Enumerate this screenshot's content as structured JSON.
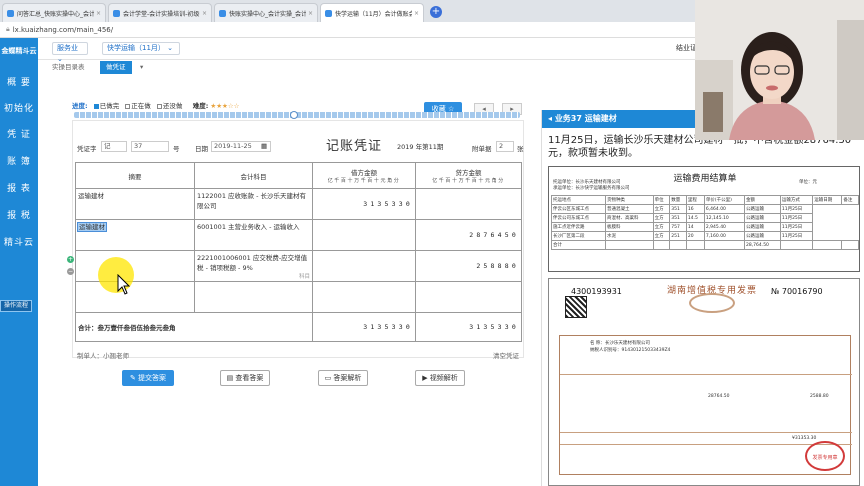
{
  "browser": {
    "tabs": [
      {
        "title": "问答汇总_快账实操中心_会计实操"
      },
      {
        "title": "会计学堂-会计实操培训-初级中级"
      },
      {
        "title": "快账实操中心_会计实操_会计做账"
      },
      {
        "title": "快学运输（11月）会计做账会计实操"
      }
    ],
    "url": "lx.kuaizhang.com/main_456/"
  },
  "sidebar": {
    "logo": "金蝶精斗云",
    "items": [
      "概 要",
      "初始化",
      "凭 证",
      "账 簿",
      "报 表",
      "报 税",
      "精斗云"
    ],
    "flow_button": "操作流程"
  },
  "header": {
    "industry": "服务业",
    "company": "快学运输（11月）",
    "right_text": "结业证"
  },
  "subtabs": [
    "实操目录表",
    "做凭证"
  ],
  "progress": {
    "label": "进度:",
    "done": "已做完",
    "doing": "正在做",
    "notdone": "还没做",
    "difficulty_label": "难度:",
    "difficulty_stars": 3,
    "favorite": "收藏 ☆"
  },
  "voucher": {
    "title": "记账凭证",
    "period": "2019 年第11期",
    "word_label": "凭证字",
    "word_value": "记",
    "number": "37",
    "number_unit": "号",
    "date_label": "日期",
    "date_value": "2019-11-25",
    "attach_label": "附单据",
    "attach_value": "2",
    "attach_unit": "张",
    "col_summary": "摘要",
    "col_account": "会计科目",
    "col_debit": "借方金额",
    "col_credit": "贷方金额",
    "digit_header": "亿千百十万千百十元角分",
    "rows": [
      {
        "summary": "运输建材",
        "account": "1122001 应收账款 - 长沙乐天建材有限公司",
        "debit": "3135330",
        "credit": "",
        "note": ""
      },
      {
        "summary": "运输建材",
        "account": "6001001 主营业务收入 - 运输收入",
        "debit": "",
        "credit": "2876450",
        "note": ""
      },
      {
        "summary": "",
        "account": "2221001006001 应交税费-应交增值税 - 销项税额 - 9%",
        "debit": "",
        "credit": "258880",
        "note": "科目"
      },
      {
        "summary": "",
        "account": "",
        "debit": "",
        "credit": "",
        "note": ""
      }
    ],
    "total_label": "合计：叁万壹仟叁佰伍拾叁元叁角",
    "total_debit": "3135330",
    "total_credit": "3135330",
    "maker": "制单人：小翘老师",
    "clear": "清空凭证"
  },
  "actions": {
    "submit": "提交答案",
    "view": "查看答案",
    "analysis": "答案解析",
    "video": "视频解析"
  },
  "task": {
    "title": "业务37 运输建材",
    "description": "11月25日，运输长沙乐天建材公司建材一批，不含税金额28764.50元，款项暂未收到。"
  },
  "settlement": {
    "title": "运输费用结算单",
    "company": "托运单位：长沙乐天建材有限公司",
    "carrier": "承运单位：长沙快学运输服务有限公司",
    "unit": "单位：元",
    "headers": [
      "托运地点",
      "货物种类",
      "单位",
      "数量",
      "里程",
      "单价(千公里)",
      "金额",
      "运输方式",
      "运输日期",
      "备注"
    ],
    "rows": [
      [
        "伴云公区东城工点",
        "普通混凝土",
        "立方",
        "351",
        "16",
        "6,464.00",
        "公路运输",
        "11月25日"
      ],
      [
        "伴云公司东城工点",
        "商混材、高粱料",
        "立方",
        "351",
        "14.5",
        "12,145.10",
        "公路运输",
        "11月25日"
      ],
      [
        "施工点近伴云路",
        "板膜料",
        "立方",
        "757",
        "14",
        "2,945.40",
        "公路运输",
        "11月25日"
      ],
      [
        "长沙厂区第二段",
        "水泥",
        "立方",
        "251",
        "20",
        "7,160.00",
        "公路运输",
        "11月25日"
      ]
    ],
    "total_label": "合计",
    "total": "28,764.50"
  },
  "invoice": {
    "code": "4300193931",
    "title": "湖南增值税专用发票",
    "no_symbol": "№",
    "number": "70016790",
    "buyer": "名    称：长沙乐天建材有限公司",
    "tax_id": "纳税人识别号：914301215033439Z4",
    "amount": "28764.50",
    "tax": "2588.80",
    "total": "¥31353.30",
    "stamp_text": "发票专用章"
  },
  "colors": {
    "primary": "#1e88d6",
    "button": "#2e8fe0",
    "stamp": "#d23a3a"
  }
}
